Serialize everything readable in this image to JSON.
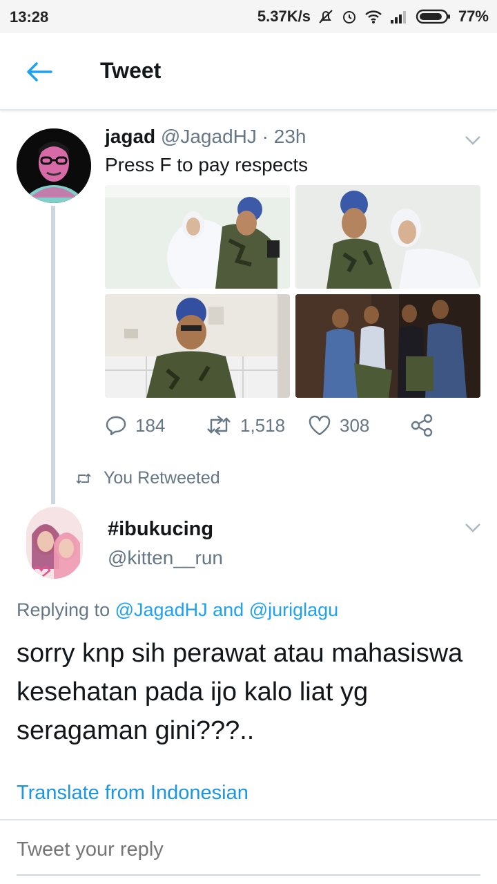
{
  "status_bar": {
    "time": "13:28",
    "network_speed": "5.37K/s",
    "battery": "77%",
    "icons": [
      "muted-bell-icon",
      "alarm-icon",
      "wifi-icon",
      "signal-icon",
      "battery-icon"
    ]
  },
  "header": {
    "title": "Tweet",
    "back_icon": "arrow-left-icon"
  },
  "tweet": {
    "author_name": "jagad",
    "author_handle": "@JagadHJ",
    "separator": " · ",
    "time": "23h",
    "text": "Press F to pay respects",
    "photos": [
      "photo-1",
      "photo-2",
      "photo-3",
      "photo-4"
    ],
    "replies": "184",
    "retweets": "1,518",
    "likes": "308"
  },
  "retweet_notice": "You Retweeted",
  "reply": {
    "author_name": "#ibukucing",
    "author_handle": "@kitten__run",
    "replying_prefix": "Replying to",
    "mention_1": "@JagadHJ",
    "and_text": "and",
    "mention_2": "@juriglagu",
    "text": "sorry knp sih perawat atau mahasiswa kesehatan pada ijo kalo liat yg seragaman gini???..",
    "translate_label": "Translate from Indonesian"
  },
  "compose": {
    "placeholder": "Tweet your reply"
  },
  "colors": {
    "accent": "#1da1f2",
    "secondary_text": "#657786",
    "primary_text": "#14171a",
    "divider": "#e1e8ed"
  }
}
